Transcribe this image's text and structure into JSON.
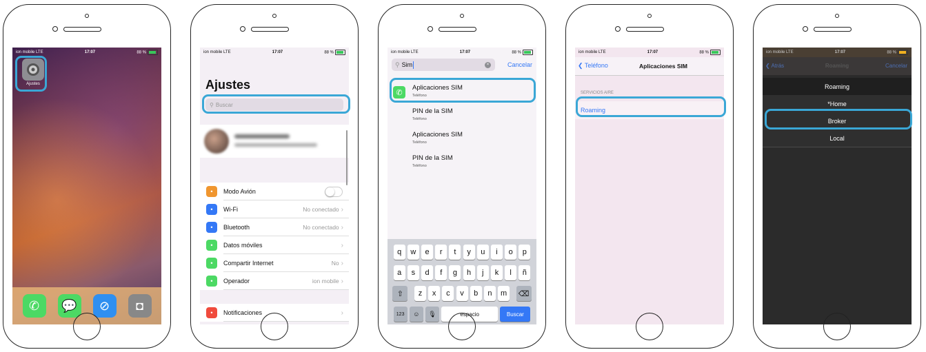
{
  "status": {
    "carrier": "ion mobile LTE",
    "time": "17:07",
    "battery": "88 %"
  },
  "s1": {
    "app_label": "Ajustes"
  },
  "s2": {
    "title": "Ajustes",
    "search_placeholder": "Buscar",
    "rows": [
      {
        "label": "Modo Avión",
        "value": "",
        "color": "#f0962f",
        "icon": "airplane-icon"
      },
      {
        "label": "Wi-Fi",
        "value": "No conectado",
        "color": "#3478f6",
        "icon": "wifi-icon"
      },
      {
        "label": "Bluetooth",
        "value": "No conectado",
        "color": "#3478f6",
        "icon": "bluetooth-icon"
      },
      {
        "label": "Datos móviles",
        "value": "",
        "color": "#4cd964",
        "icon": "antenna-icon"
      },
      {
        "label": "Compartir Internet",
        "value": "No",
        "color": "#4cd964",
        "icon": "hotspot-icon"
      },
      {
        "label": "Operador",
        "value": "ion mobile",
        "color": "#4cd964",
        "icon": "phone-icon"
      },
      {
        "label": "Notificaciones",
        "value": "",
        "color": "#f04b3d",
        "icon": "notifications-icon"
      }
    ]
  },
  "s3": {
    "search_value": "Sim",
    "cancel": "Cancelar",
    "results": [
      {
        "title": "Aplicaciones SIM",
        "subtitle": "Teléfono"
      },
      {
        "title": "PIN de la SIM",
        "subtitle": "Teléfono"
      },
      {
        "title": "Aplicaciones SIM",
        "subtitle": "Teléfono"
      },
      {
        "title": "PIN de la SIM",
        "subtitle": "Teléfono"
      }
    ],
    "keys_row1": [
      "q",
      "w",
      "e",
      "r",
      "t",
      "y",
      "u",
      "i",
      "o",
      "p"
    ],
    "keys_row2": [
      "a",
      "s",
      "d",
      "f",
      "g",
      "h",
      "j",
      "k",
      "l",
      "ñ"
    ],
    "keys_row3": [
      "z",
      "x",
      "c",
      "v",
      "b",
      "n",
      "m"
    ],
    "key_123": "123",
    "key_space": "espacio",
    "key_search": "Buscar"
  },
  "s4": {
    "back": "Teléfono",
    "title": "Aplicaciones SIM",
    "section": "SERVICIOS AIRE",
    "item": "Roaming"
  },
  "s5": {
    "back": "Atrás",
    "title": "Roaming",
    "cancel": "Cancelar",
    "options": [
      "Roaming",
      "*Home",
      "Broker",
      "Local"
    ]
  },
  "colors": {
    "highlight": "#3aa7d6",
    "ios_blue": "#3478f6"
  }
}
